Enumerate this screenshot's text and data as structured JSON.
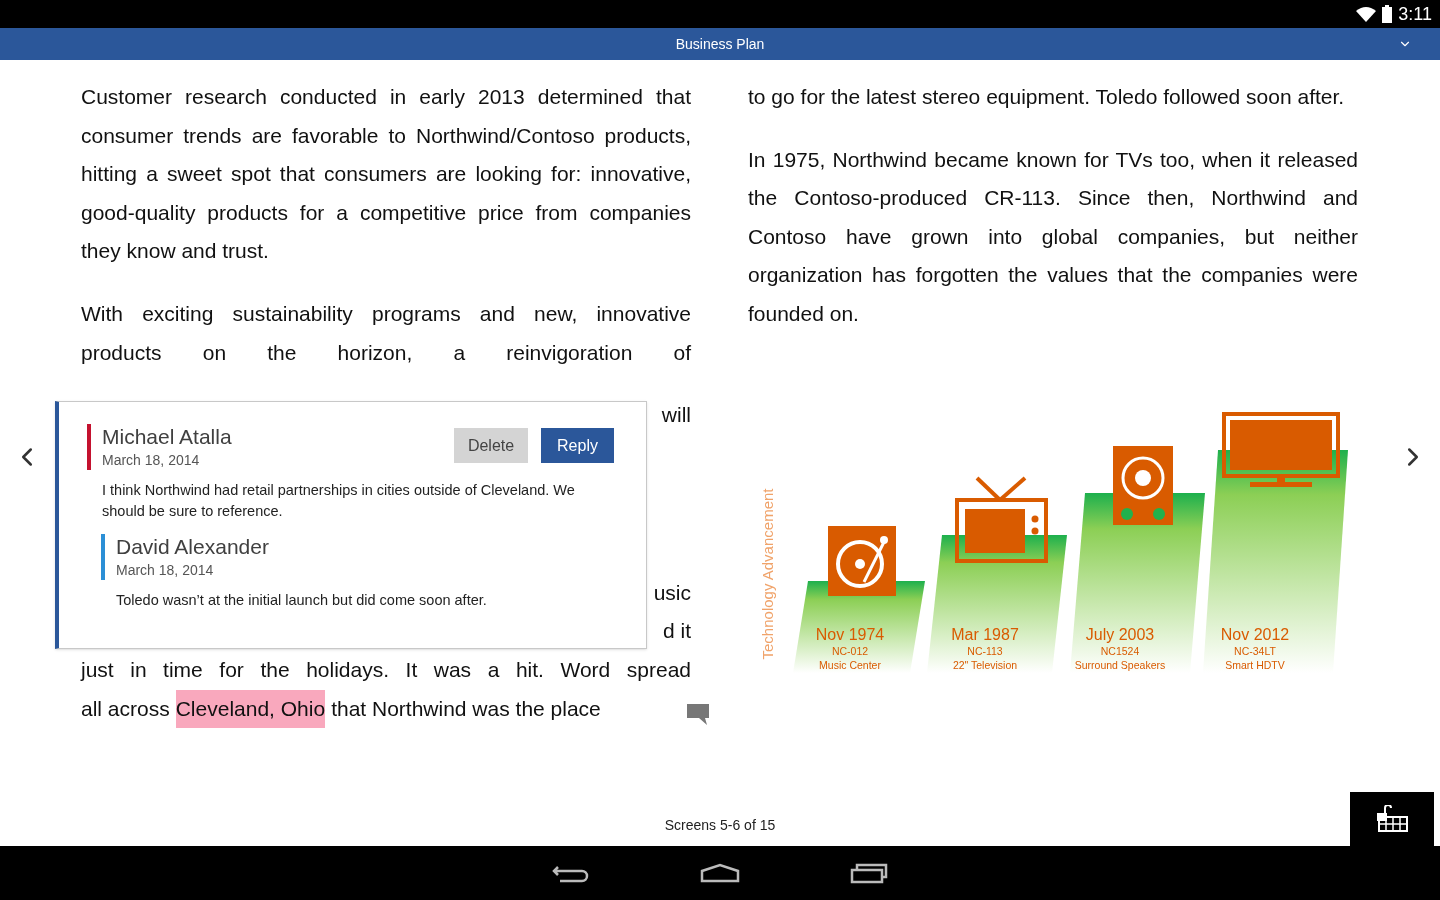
{
  "status_bar": {
    "time": "3:11"
  },
  "title_bar": {
    "title": "Business Plan"
  },
  "left_column": {
    "paragraphs": [
      "Customer research conducted in early 2013 determined that consumer trends are favorable to Northwind/Contoso products, hitting a sweet spot that consumers are looking for: innovative, good-quality products for a competitive price from companies they know and trust.",
      "With exciting sustainability programs and new, innovative products on the horizon, a reinvigoration of"
    ],
    "partial_lines": [
      "will",
      "usic",
      "d it"
    ],
    "lines_after": [
      "just in time for the holidays. It was a hit. Word spread"
    ],
    "highlighted_line": {
      "before": "all across",
      "highlight": "Cleveland, Ohio",
      "after": "that Northwind was the place"
    }
  },
  "right_column": {
    "paragraphs": [
      "to go for the latest stereo equipment. Toledo followed soon after.",
      "In 1975, Northwind became known for TVs too, when it released the Contoso-produced CR-113. Since then, Northwind and Contoso have grown into global companies, but neither organization has forgotten the values that the companies were founded on."
    ]
  },
  "infographic": {
    "axis_label": "Technology Advancement",
    "steps": [
      {
        "kind": "turntable",
        "date": "Nov 1974",
        "model": "NC-012",
        "name": "Music Center"
      },
      {
        "kind": "tv",
        "date": "Mar 1987",
        "model": "NC-113",
        "name": "22\" Television"
      },
      {
        "kind": "speaker",
        "date": "July 2003",
        "model": "NC1524",
        "name": "Surround Speakers"
      },
      {
        "kind": "monitor",
        "date": "Nov 2012",
        "model": "NC-34LT",
        "name": "Smart HDTV"
      }
    ]
  },
  "comment_popup": {
    "buttons": {
      "delete": "Delete",
      "reply": "Reply"
    },
    "comment": {
      "author": "Michael Atalla",
      "date": "March 18, 2014",
      "color": "#c4122f",
      "text": "I think Northwind had retail partnerships in cities outside of Cleveland. We should be sure to reference.",
      "replies": [
        {
          "author": "David Alexander",
          "date": "March 18, 2014",
          "color": "#2b8fd6",
          "text": "Toledo wasn’t at the initial launch but did come soon after."
        }
      ]
    }
  },
  "footer": {
    "page_indicator": "Screens 5-6 of 15"
  }
}
